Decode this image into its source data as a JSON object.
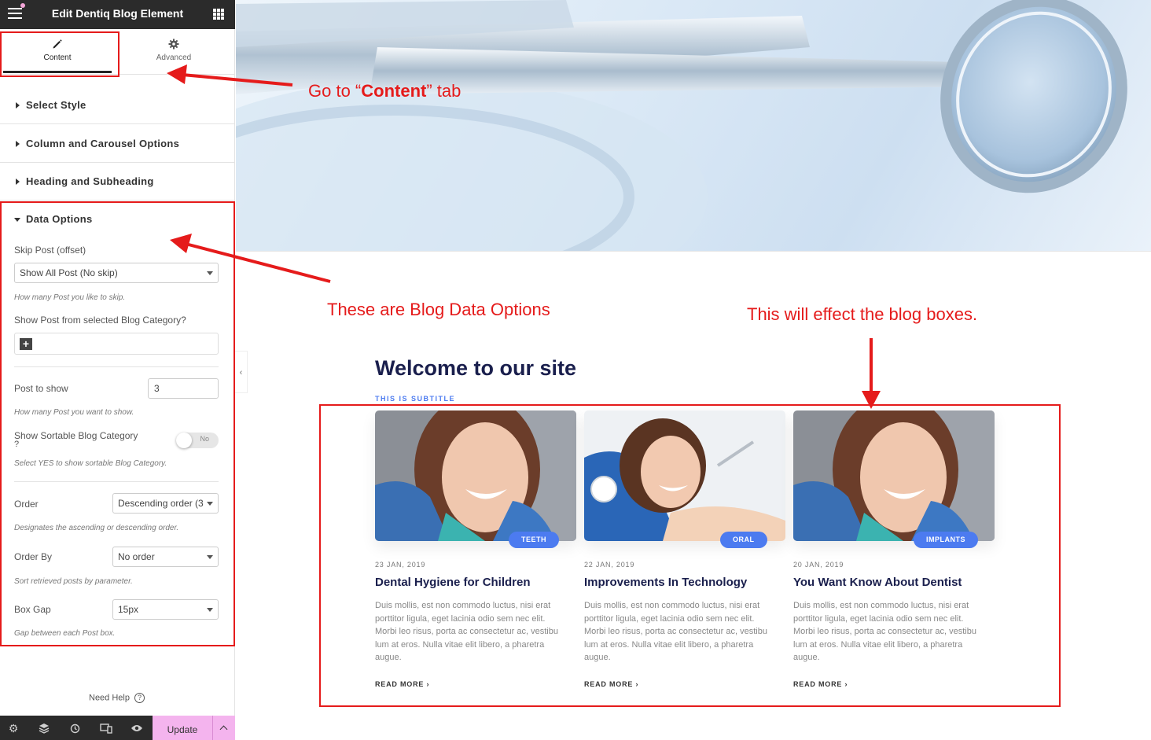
{
  "sidebar": {
    "title": "Edit Dentiq Blog Element",
    "tabs": [
      {
        "label": "Content"
      },
      {
        "label": "Advanced"
      }
    ],
    "sections": [
      {
        "label": "Select Style"
      },
      {
        "label": "Column and Carousel Options"
      },
      {
        "label": "Heading and Subheading"
      },
      {
        "label": "Data Options"
      }
    ],
    "data_options": {
      "skip_post": {
        "label": "Skip Post (offset)",
        "value": "Show All Post (No skip)",
        "help": "How many Post you like to skip."
      },
      "category": {
        "label": "Show Post from selected Blog Category?"
      },
      "post_to_show": {
        "label": "Post to show",
        "value": "3",
        "help": "How many Post you want to show."
      },
      "sortable": {
        "label": "Show Sortable Blog Category",
        "label_suffix": "?",
        "toggle_text": "No",
        "help": "Select YES to show sortable Blog Category."
      },
      "order": {
        "label": "Order",
        "value": "Descending order (3",
        "help": "Designates the ascending or descending order."
      },
      "order_by": {
        "label": "Order By",
        "value": "No order",
        "help": "Sort retrieved posts by parameter."
      },
      "box_gap": {
        "label": "Box Gap",
        "value": "15px",
        "help": "Gap between each Post box."
      }
    },
    "need_help": "Need Help",
    "update_label": "Update"
  },
  "preview": {
    "title": "Welcome to our site",
    "subtitle": "THIS IS SUBTITLE",
    "posts": [
      {
        "badge": "TEETH",
        "date": "23 JAN, 2019",
        "title": "Dental Hygiene for Children",
        "excerpt": "Duis mollis, est non commodo luctus, nisi erat porttitor ligula, eget lacinia odio sem nec elit. Morbi leo risus, porta ac consectetur ac, vestibu lum at eros. Nulla vitae elit libero, a pharetra augue.",
        "read_more": "READ MORE"
      },
      {
        "badge": "ORAL",
        "date": "22 JAN, 2019",
        "title": "Improvements In Technology",
        "excerpt": "Duis mollis, est non commodo luctus, nisi erat porttitor ligula, eget lacinia odio sem nec elit. Morbi leo risus, porta ac consectetur ac, vestibu lum at eros. Nulla vitae elit libero, a pharetra augue.",
        "read_more": "READ MORE"
      },
      {
        "badge": "IMPLANTS",
        "date": "20 JAN, 2019",
        "title": "You Want Know About Dentist",
        "excerpt": "Duis mollis, est non commodo luctus, nisi erat porttitor ligula, eget lacinia odio sem nec elit. Morbi leo risus, porta ac consectetur ac, vestibu lum at eros. Nulla vitae elit libero, a pharetra augue.",
        "read_more": "READ MORE"
      }
    ]
  },
  "annotations": {
    "content_tab_prefix": "Go  to “",
    "content_tab_bold": "Content",
    "content_tab_suffix": "” tab",
    "data_options": "These are Blog Data Options",
    "blog_boxes": "This will effect the blog boxes."
  },
  "colors": {
    "accent_blue": "#4c7bf0",
    "heading_navy": "#1a1f4d",
    "annotation_red": "#e51b1b",
    "update_pink": "#f4b4ee",
    "topbar_dark": "#2b2b2b"
  }
}
